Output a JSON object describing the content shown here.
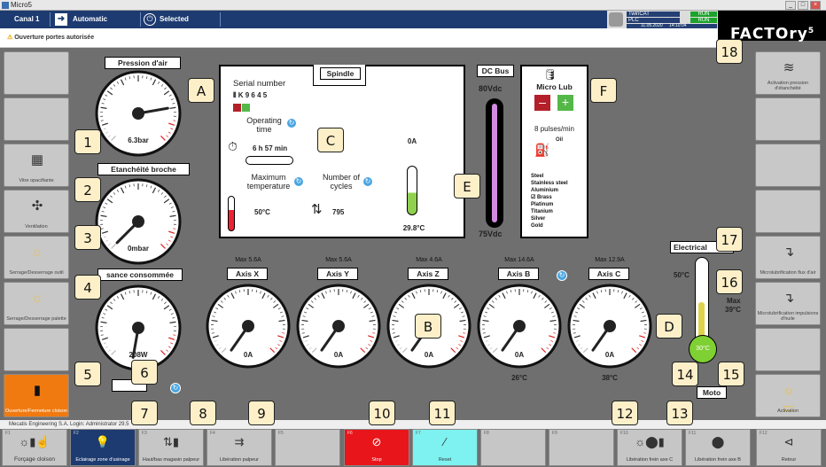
{
  "window": {
    "title": "Micro5",
    "minimize": "_",
    "maximize": "□",
    "close": "×"
  },
  "topbar": {
    "channel": "Canal 1",
    "mode": "Automatic",
    "selection": "Selected",
    "status_name1": "TwinCAT",
    "status_name2": "PLC",
    "status_state1": "RUN",
    "status_state2": "RUN",
    "date": "11.05.2020",
    "time": "14:10:04",
    "logo": "FACTOry",
    "logo_sup": "5"
  },
  "warning": {
    "text": "Ouverture portes autorisée"
  },
  "gauges": {
    "air": {
      "title": "Pression d'air",
      "value": "6.3bar"
    },
    "seal": {
      "title": "Etanchéité broche",
      "value": "0mbar"
    },
    "power": {
      "title": "Puissance consommée",
      "value": "208W",
      "visible_title": "sance consommée"
    },
    "spindle": {
      "value": "0A"
    },
    "axes": [
      {
        "title": "Axis X",
        "max": "Max 5.6A",
        "value": "0A",
        "temp": ""
      },
      {
        "title": "Axis Y",
        "max": "Max 5.6A",
        "value": "0A",
        "temp": ""
      },
      {
        "title": "Axis Z",
        "max": "Max 4.6A",
        "value": "0A",
        "temp": ""
      },
      {
        "title": "Axis B",
        "max": "Max 14.6A",
        "value": "0A",
        "temp": "26°C"
      },
      {
        "title": "Axis C",
        "max": "Max 12.9A",
        "value": "0A",
        "temp": "38°C"
      }
    ]
  },
  "spindle_panel": {
    "title": "Spindle",
    "serial_label": "Serial number",
    "serial": "K 9 6 4 5",
    "op_time_label": "Operating time",
    "op_time": "6 h   57 min",
    "max_temp_label": "Maximum temperature",
    "max_temp": "50°C",
    "cycles_label": "Number of cycles",
    "cycles": "795",
    "temp": "29.8°C"
  },
  "dcbus": {
    "title": "DC Bus",
    "max": "80Vdc",
    "min": "75Vdc"
  },
  "microlub": {
    "title": "Micro Lub",
    "pulses": "8 pulses/min",
    "oil": "Oil",
    "materials": [
      "Steel",
      "Stainless steel",
      "Aluminium",
      "Brass",
      "Platinum",
      "Titanium",
      "Silver",
      "Gold"
    ],
    "checked": "Brass"
  },
  "electrical": {
    "title": "Electrical",
    "max_temp": "50°C",
    "current_label": "Max",
    "current": "39°C",
    "temp": "30°C",
    "motor": "Moto"
  },
  "left_buttons": [
    "",
    "",
    "Vitre opacifiante",
    "Ventilation",
    "Serrage/Desserrage outil",
    "Serrage/Desserrage palette",
    "",
    "Ouverture/Fermeture cloison"
  ],
  "right_buttons": [
    "Activation pression d'étanchéité",
    "",
    "",
    "",
    "Microlubrification flux d'air",
    "Microlubrification impulsions d'huile",
    "",
    "Activation"
  ],
  "fkeys": [
    {
      "num": "F1",
      "label": "Forçage cloison"
    },
    {
      "num": "F2",
      "label": "Eclairage zone d'usinage"
    },
    {
      "num": "F3",
      "label": "Haut/bas magasin palpeur"
    },
    {
      "num": "F4",
      "label": "Libération palpeur"
    },
    {
      "num": "F5",
      "label": ""
    },
    {
      "num": "F6",
      "label": "Stop"
    },
    {
      "num": "F7",
      "label": "Reset"
    },
    {
      "num": "F8",
      "label": ""
    },
    {
      "num": "F9",
      "label": ""
    },
    {
      "num": "F10",
      "label": "Libération frein axe C"
    },
    {
      "num": "F11",
      "label": "Libération frein axe B"
    },
    {
      "num": "F12",
      "label": "Retour"
    }
  ],
  "footer": {
    "company": "Mecatis Engineering S.A.",
    "user": "Login: Administrator",
    "version": "29.5"
  },
  "callouts": [
    "A",
    "B",
    "C",
    "D",
    "E",
    "F",
    "1",
    "2",
    "3",
    "4",
    "5",
    "6",
    "7",
    "8",
    "9",
    "10",
    "11",
    "12",
    "13",
    "14",
    "15",
    "16",
    "17",
    "18"
  ],
  "colors": {
    "header": "#1d3b70",
    "panel": "#6f6f6f",
    "accent_orange": "#f07a10",
    "stop": "#e8151a",
    "reset": "#7ef2f0",
    "run": "#1ca32c",
    "callout": "#fdf0c9"
  }
}
